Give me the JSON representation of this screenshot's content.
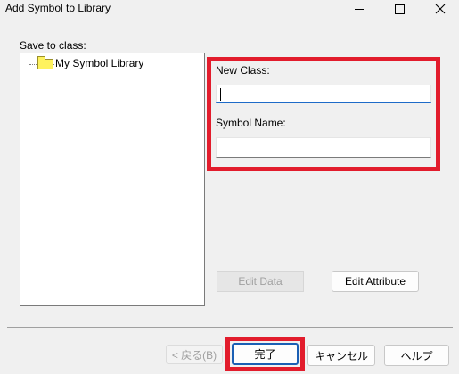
{
  "window": {
    "title": "Add Symbol to Library"
  },
  "tree": {
    "label": "Save to class:",
    "items": [
      {
        "label": "My Symbol Library",
        "icon": "folder-icon"
      }
    ]
  },
  "form": {
    "new_class_label": "New Class:",
    "new_class_value": "",
    "symbol_name_label": "Symbol Name:",
    "symbol_name_value": ""
  },
  "buttons": {
    "edit_data": "Edit Data",
    "edit_attribute": "Edit Attribute",
    "back": "< 戻る(B)",
    "finish": "完了",
    "cancel": "キャンセル",
    "help": "ヘルプ"
  },
  "colors": {
    "highlight_annotation": "#e21c2c",
    "focus_accent": "#1e6bc8",
    "folder": "#fef25e"
  }
}
